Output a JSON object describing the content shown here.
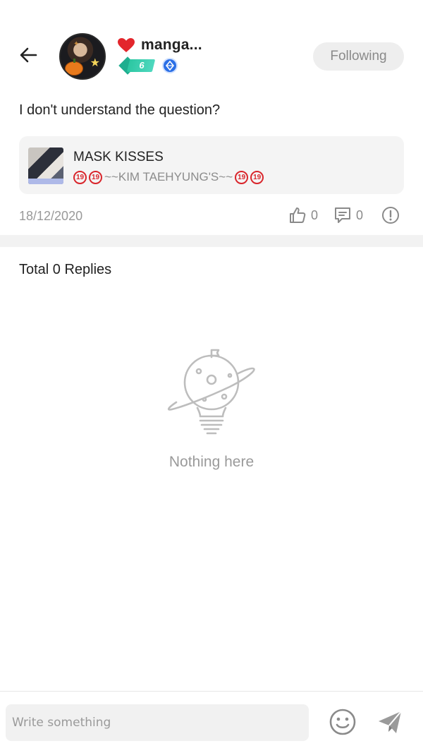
{
  "header": {
    "username": "manga...",
    "level": "6",
    "follow_label": "Following"
  },
  "post": {
    "question": "I don't understand the question?",
    "link_card": {
      "title": "MASK KISSES",
      "subtitle_text": "~~KIM TAEHYUNG'S~~",
      "age_badge": "19"
    },
    "date": "18/12/2020",
    "like_count": "0",
    "comment_count": "0"
  },
  "replies": {
    "title": "Total 0 Replies",
    "empty_text": "Nothing here"
  },
  "composer": {
    "placeholder": "Write something"
  },
  "icons": {
    "back": "arrow-left-icon",
    "heart": "heart-icon",
    "mod": "moderator-icon",
    "like": "thumbs-up-icon",
    "comment": "comment-icon",
    "report": "report-icon",
    "emoji": "smiley-icon",
    "send": "send-icon",
    "illustration": "planet-lightbulb-icon"
  },
  "colors": {
    "heart": "#e3262c",
    "level_badge": "#2cc7a2",
    "mod_badge": "#2b6fe6",
    "age_badge": "#d9262c",
    "muted_text": "#9a9a9a"
  }
}
